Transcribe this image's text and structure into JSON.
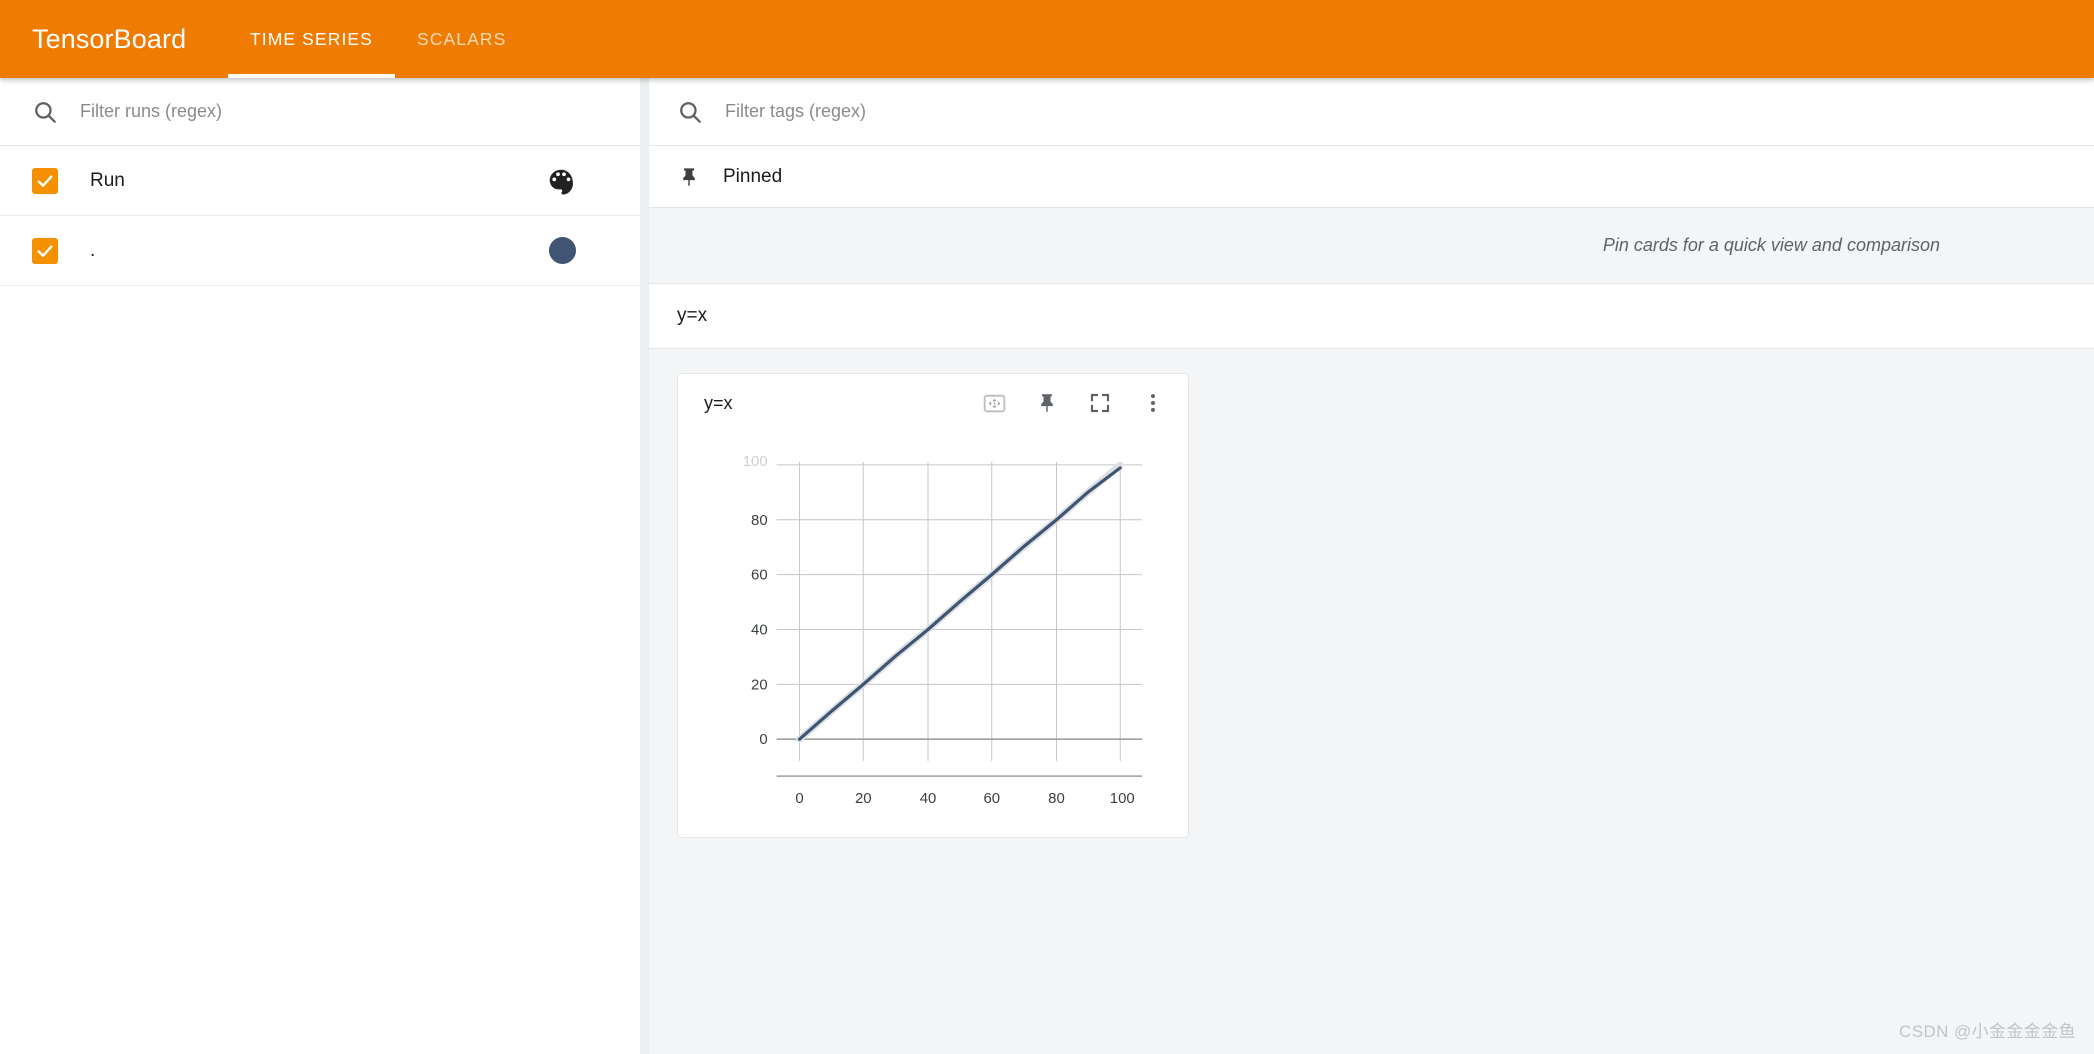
{
  "app": {
    "brand": "TensorBoard",
    "accent_color": "#ef7c00",
    "checkbox_color": "#f59100"
  },
  "toolbar": {
    "tabs": [
      {
        "label": "TIME SERIES",
        "active": true
      },
      {
        "label": "SCALARS",
        "active": false
      }
    ]
  },
  "sidebar": {
    "runs_filter": {
      "placeholder": "Filter runs (regex)",
      "value": ""
    },
    "header_row": {
      "label": "Run",
      "checked": true,
      "icon": "palette-icon"
    },
    "runs": [
      {
        "label": ".",
        "checked": true,
        "color": "#3f5573"
      }
    ]
  },
  "main": {
    "tags_filter": {
      "placeholder": "Filter tags (regex)",
      "value": ""
    },
    "pinned": {
      "title": "Pinned",
      "icon": "pin-icon",
      "empty_message": "Pin cards for a quick view and comparison"
    },
    "group": {
      "title": "y=x"
    },
    "card": {
      "title": "y=x",
      "actions": [
        {
          "name": "fit-domain-icon",
          "label": "Reset domain"
        },
        {
          "name": "pin-icon",
          "label": "Pin card"
        },
        {
          "name": "fullscreen-icon",
          "label": "Toggle fullscreen"
        },
        {
          "name": "more-vert-icon",
          "label": "More options"
        }
      ]
    }
  },
  "chart_data": {
    "type": "line",
    "title": "y=x",
    "xlabel": "",
    "ylabel": "",
    "xlim": [
      -8,
      108
    ],
    "ylim": [
      -9,
      103
    ],
    "xticks": [
      0,
      20,
      40,
      60,
      80,
      100
    ],
    "yticks": [
      0,
      20,
      40,
      60,
      80,
      100
    ],
    "ytick_clipped_top": "100",
    "grid": true,
    "legend": false,
    "series": [
      {
        "name": ".",
        "color": "#3f5573",
        "x": [
          0,
          10,
          20,
          30,
          40,
          50,
          60,
          70,
          80,
          90,
          100
        ],
        "y": [
          0,
          10,
          20,
          30,
          40,
          50,
          60,
          70,
          80,
          90,
          100
        ]
      },
      {
        "name": ". (unsmoothed)",
        "color": "#dcdfe3",
        "x": [
          0,
          10,
          20,
          30,
          40,
          50,
          60,
          70,
          80,
          90,
          100
        ],
        "y": [
          0,
          10,
          20,
          30,
          40,
          50,
          60,
          70,
          80,
          90,
          100
        ]
      }
    ]
  },
  "watermark": {
    "text": "CSDN @小金金金金鱼"
  }
}
